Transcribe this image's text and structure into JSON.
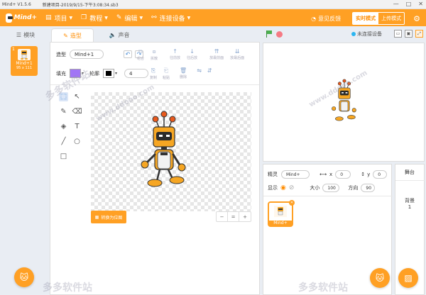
{
  "titlebar": {
    "app": "Mind+ V1.5.6",
    "project": "新建项目-2019/9/15-下午3:08:34.sb3",
    "controls": [
      "—",
      "□",
      "✕"
    ]
  },
  "menubar": {
    "logo": "Mind+",
    "items": [
      "项目",
      "教程",
      "编辑",
      "连接设备"
    ],
    "feedback": "意见反馈",
    "mode_realtime": "实时模式",
    "mode_upload": "上传模式"
  },
  "tabs": [
    {
      "label": "模块",
      "icon": "☰"
    },
    {
      "label": "造型",
      "icon": "✎"
    },
    {
      "label": "声音",
      "icon": "🔈"
    }
  ],
  "stage_bar": {
    "connection": "未连接设备"
  },
  "costume_list": {
    "number": "1",
    "name": "Mind+1",
    "size": "95 x 111"
  },
  "editor": {
    "costume_label": "造型",
    "costume_name": "Mind+1",
    "undo": "↶",
    "redo": "↷",
    "top_tools": [
      {
        "label": "组合",
        "glyph": "⧉"
      },
      {
        "label": "拆散",
        "glyph": "⧇"
      },
      {
        "label": "往前放",
        "glyph": "↑"
      },
      {
        "label": "往后放",
        "glyph": "↓"
      },
      {
        "label": "放最前面",
        "glyph": "⇈"
      },
      {
        "label": "放最后面",
        "glyph": "⇊"
      }
    ],
    "fill_label": "填充",
    "outline_label": "轮廓",
    "fill_color": "#a175f5",
    "outline_color": "#000000",
    "outline_width": "4",
    "second_tools": [
      {
        "label": "复制",
        "glyph": "⎘"
      },
      {
        "label": "粘贴",
        "glyph": "⎗"
      },
      {
        "label": "删除",
        "glyph": "🗑"
      }
    ],
    "flip": [
      "⇋",
      "⇵"
    ],
    "palette": [
      "⬚",
      "↖",
      "✎",
      "⌫",
      "◈",
      "T",
      "╱",
      "○",
      "□"
    ],
    "convert": "转换为位图",
    "zoom": [
      "−",
      "=",
      "+"
    ]
  },
  "sprite_info": {
    "sprite_label": "精灵",
    "sprite_name": "Mind+",
    "x_label": "x",
    "x": "0",
    "y_label": "y",
    "y": "0",
    "show_label": "显示",
    "size_label": "大小",
    "size": "100",
    "direction_label": "方向",
    "direction": "90",
    "tile_label": "Mind+"
  },
  "stage_panel": {
    "title": "舞台",
    "backdrop_label": "背景",
    "backdrop_count": "1"
  },
  "watermark": [
    "多多软件站",
    "www.ddooo.com"
  ],
  "colors": {
    "accent": "#ffa024",
    "stop": "#f57a84",
    "go": "#4caf50"
  }
}
